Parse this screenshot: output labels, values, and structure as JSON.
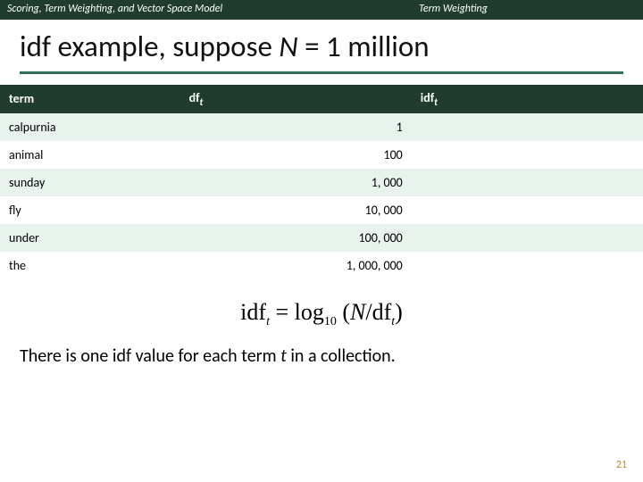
{
  "header": {
    "left": "Scoring, Term Weighting, and Vector Space Model",
    "right": "Term Weighting"
  },
  "title": {
    "pre": "idf example, suppose ",
    "var": "N",
    "post": " = 1 million"
  },
  "table": {
    "head": {
      "c1": "term",
      "c2_base": "df",
      "c2_sub": "t",
      "c3_base": "idf",
      "c3_sub": "t"
    },
    "rows": [
      {
        "term": "calpurnia",
        "df": "1",
        "idf": ""
      },
      {
        "term": "animal",
        "df": "100",
        "idf": ""
      },
      {
        "term": "sunday",
        "df": "1, 000",
        "idf": ""
      },
      {
        "term": "fly",
        "df": "10, 000",
        "idf": ""
      },
      {
        "term": "under",
        "df": "100, 000",
        "idf": ""
      },
      {
        "term": "the",
        "df": "1, 000, 000",
        "idf": ""
      }
    ]
  },
  "formula": {
    "lhs_base": "idf",
    "lhs_sub": "t",
    "eq": " = log",
    "logsub": "10",
    "open": " (",
    "N": "N",
    "slash": "/",
    "df_base": "df",
    "df_sub": "t",
    "close": ")"
  },
  "sentence": {
    "pre": "There is one idf value for each term ",
    "var": "t",
    "post": " in a collection."
  },
  "page": "21"
}
